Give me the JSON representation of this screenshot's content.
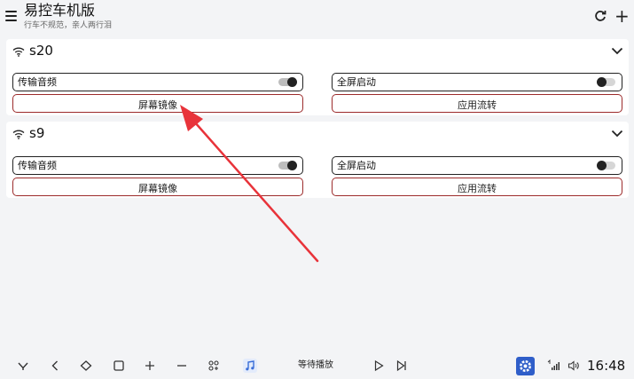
{
  "header": {
    "title": "易控车机版",
    "subtitle": "行车不规范，亲人两行泪"
  },
  "devices": [
    {
      "name": "s20",
      "audio_label": "传输音频",
      "audio_on": true,
      "fullscreen_label": "全屏启动",
      "fullscreen_on": false,
      "mirror_label": "屏幕镜像",
      "app_stream_label": "应用流转"
    },
    {
      "name": "s9",
      "audio_label": "传输音频",
      "audio_on": true,
      "fullscreen_label": "全屏启动",
      "fullscreen_on": false,
      "mirror_label": "屏幕镜像",
      "app_stream_label": "应用流转"
    }
  ],
  "dock": {
    "media_status": "等待播放",
    "time": "16:48"
  },
  "colors": {
    "background": "#f3f4f6",
    "button_border": "#9c2b2b",
    "annotation_arrow": "#e8333a",
    "settings_icon_bg": "#2f5ec9"
  }
}
